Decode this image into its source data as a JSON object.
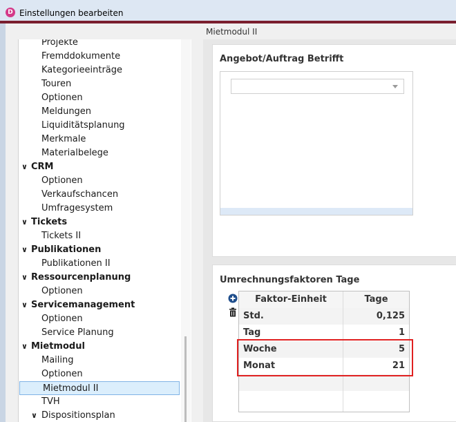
{
  "window": {
    "title": "Einstellungen bearbeiten",
    "app_icon_letter": "D"
  },
  "tab": {
    "label": "Mietmodul II"
  },
  "tree": {
    "items": [
      {
        "label": "Projekte",
        "level": 2
      },
      {
        "label": "Fremddokumente",
        "level": 2
      },
      {
        "label": "Kategorieeinträge",
        "level": 2
      },
      {
        "label": "Touren",
        "level": 2
      },
      {
        "label": "Optionen",
        "level": 2
      },
      {
        "label": "Meldungen",
        "level": 2
      },
      {
        "label": "Liquiditätsplanung",
        "level": 2
      },
      {
        "label": "Merkmale",
        "level": 2
      },
      {
        "label": "Materialbelege",
        "level": 2
      },
      {
        "label": "CRM",
        "level": 1,
        "expanded": true
      },
      {
        "label": "Optionen",
        "level": 2
      },
      {
        "label": "Verkaufschancen",
        "level": 2
      },
      {
        "label": "Umfragesystem",
        "level": 2
      },
      {
        "label": "Tickets",
        "level": 1,
        "expanded": true
      },
      {
        "label": "Tickets II",
        "level": 2
      },
      {
        "label": "Publikationen",
        "level": 1,
        "expanded": true
      },
      {
        "label": "Publikationen II",
        "level": 2
      },
      {
        "label": "Ressourcenplanung",
        "level": 1,
        "expanded": true
      },
      {
        "label": "Optionen",
        "level": 2
      },
      {
        "label": "Servicemanagement",
        "level": 1,
        "expanded": true
      },
      {
        "label": "Optionen",
        "level": 2
      },
      {
        "label": "Service Planung",
        "level": 2
      },
      {
        "label": "Mietmodul",
        "level": 1,
        "expanded": true
      },
      {
        "label": "Mailing",
        "level": 2
      },
      {
        "label": "Optionen",
        "level": 2
      },
      {
        "label": "Mietmodul II",
        "level": 2,
        "selected": true
      },
      {
        "label": "TVH",
        "level": 2
      },
      {
        "label": "Dispositionsplan",
        "level": 2,
        "caret": true
      }
    ]
  },
  "card_angebot": {
    "title": "Angebot/Auftrag Betrifft",
    "select_value": ""
  },
  "card_umrechnung": {
    "title": "Umrechnungsfaktoren Tage",
    "columns": [
      "Faktor-Einheit",
      "Tage"
    ],
    "rows": [
      {
        "unit": "Std.",
        "days": "0,125"
      },
      {
        "unit": "Tag",
        "days": "1"
      },
      {
        "unit": "Woche",
        "days": "5"
      },
      {
        "unit": "Monat",
        "days": "21"
      }
    ]
  },
  "colors": {
    "accent": "#7a1f2e",
    "highlight": "#e02020",
    "selection": "#dbeefc",
    "add_icon": "#1f4e8c"
  }
}
